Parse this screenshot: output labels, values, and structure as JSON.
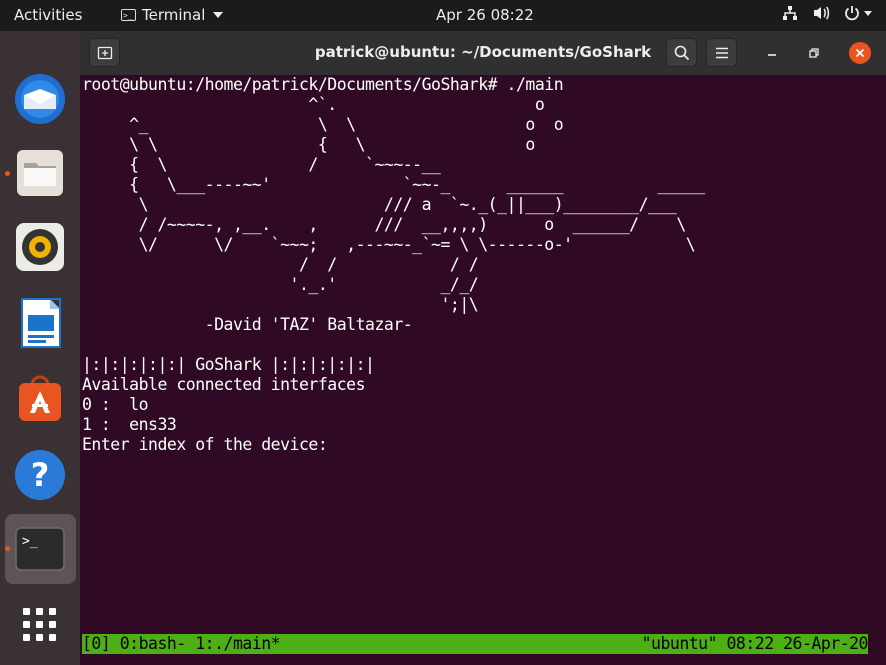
{
  "topbar": {
    "activities": "Activities",
    "app_name": "Terminal",
    "clock": "Apr 26  08:22"
  },
  "dock": {
    "items": [
      {
        "name": "thunderbird-mail",
        "icon": "mail-icon",
        "running": false
      },
      {
        "name": "files",
        "icon": "folder-icon",
        "running": true
      },
      {
        "name": "rhythmbox",
        "icon": "speaker-icon",
        "running": false
      },
      {
        "name": "libreoffice-writer",
        "icon": "document-icon",
        "running": false
      },
      {
        "name": "ubuntu-software",
        "icon": "software-bag-icon",
        "running": false
      },
      {
        "name": "help",
        "icon": "help-icon",
        "running": false
      },
      {
        "name": "terminal",
        "icon": "terminal-icon",
        "running": true,
        "active": true
      },
      {
        "name": "show-applications",
        "icon": "app-grid-icon",
        "running": false
      }
    ]
  },
  "window": {
    "title": "patrick@ubuntu: ~/Documents/GoShark"
  },
  "terminal": {
    "lines": [
      "root@ubuntu:/home/patrick/Documents/GoShark# ./main",
      "                        ^`.                     o",
      "     ^_                  \\  \\                  o  o",
      "     \\ \\                 {   \\                 o",
      "     {  \\               /     `~~~--__",
      "     {   \\___----~~'              `~~-_      ______          _____",
      "      \\                         /// a  `~._(_||___)________/___",
      "      / /~~~~-, ,__.    ,      ///  __,,,,)      o  ______/    \\",
      "      \\/      \\/    `~~~;   ,---~~-_`~= \\ \\------o-'            \\",
      "                       /  /            / /",
      "                      '._.'           _/_/",
      "                                      ';|\\",
      "             -David 'TAZ' Baltazar-",
      "",
      "|:|:|:|:|:| GoShark |:|:|:|:|:|",
      "Available connected interfaces",
      "0 :  lo",
      "1 :  ens33",
      "Enter index of the device:"
    ]
  },
  "tmux": {
    "left": "[0] 0:bash- 1:./main*",
    "right": "\"ubuntu\" 08:22 26-Apr-20"
  },
  "colors": {
    "terminal_bg": "#300a24",
    "tmux_bar": "#4caf13",
    "accent": "#e95420"
  }
}
